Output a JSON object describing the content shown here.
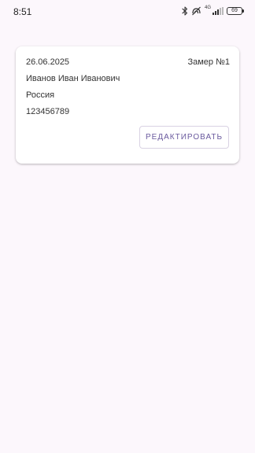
{
  "status_bar": {
    "time": "8:51",
    "network": "4G",
    "battery": "69",
    "icons": [
      "bluetooth-icon",
      "nfc-icon",
      "signal-icon",
      "battery-icon"
    ]
  },
  "card": {
    "date": "26.06.2025",
    "measure": "Замер №1",
    "name": "Иванов Иван Иванович",
    "country": "Россия",
    "phone": "123456789",
    "edit_label": "РЕДАКТИРОВАТЬ"
  },
  "colors": {
    "background": "#fcf7fc",
    "card": "#ffffff",
    "accent": "#6a5a9e",
    "button_border": "#d9d2e3"
  }
}
